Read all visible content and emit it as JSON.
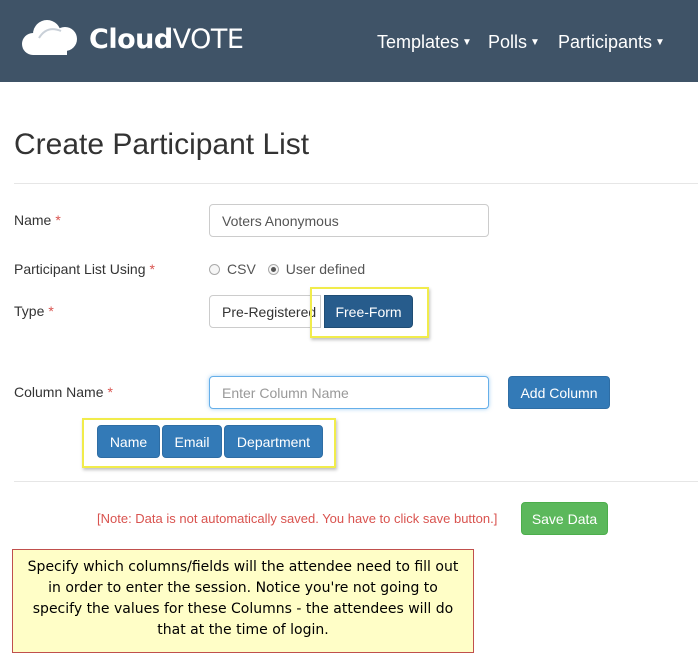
{
  "brand": {
    "name_bold": "Cloud",
    "name_light": "VOTE",
    "logo": "cloud-logo-icon"
  },
  "nav": {
    "items": [
      {
        "label": "Templates",
        "icon": "caret-down-icon"
      },
      {
        "label": "Polls",
        "icon": "caret-down-icon"
      },
      {
        "label": "Participants",
        "icon": "caret-down-icon"
      }
    ]
  },
  "page": {
    "title": "Create Participant List"
  },
  "form": {
    "name": {
      "label": "Name",
      "required_mark": "*",
      "value": "Voters Anonymous"
    },
    "list_using": {
      "label": "Participant List Using",
      "required_mark": "*",
      "options": [
        {
          "label": "CSV",
          "checked": false
        },
        {
          "label": "User defined",
          "checked": true
        }
      ]
    },
    "type": {
      "label": "Type",
      "required_mark": "*",
      "options": [
        {
          "label": "Pre-Registered",
          "active": false
        },
        {
          "label": "Free-Form",
          "active": true
        }
      ]
    },
    "column_name": {
      "label": "Column Name",
      "required_mark": "*",
      "value": "",
      "placeholder": "Enter Column Name",
      "add_button": "Add Column"
    },
    "columns": [
      "Name",
      "Email",
      "Department"
    ]
  },
  "note": "[Note: Data is not automatically saved. You have to click save button.]",
  "save_button": "Save Data",
  "callout": "Specify which columns/fields will the attendee need to fill out in order to enter the session. Notice you're not going to specify the values for these Columns - the attendees will do that at the time of login.",
  "colors": {
    "navbar": "#3f5367",
    "primary": "#337ab7",
    "success": "#5cb85c",
    "required": "#d9534f",
    "highlight": "#f1ec4b",
    "callout_bg": "#fffec7",
    "callout_border": "#c0504d"
  }
}
